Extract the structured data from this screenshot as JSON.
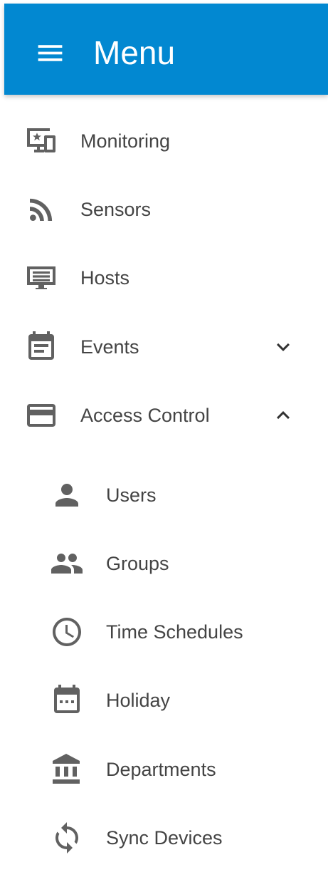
{
  "header": {
    "title": "Menu",
    "menu_icon": "hamburger-menu-icon",
    "background_color": "#0288d1"
  },
  "nav": {
    "items": [
      {
        "label": "Monitoring",
        "icon": "monitoring-devices-icon"
      },
      {
        "label": "Sensors",
        "icon": "rss-feed-icon"
      },
      {
        "label": "Hosts",
        "icon": "host-list-icon"
      },
      {
        "label": "Events",
        "icon": "event-note-icon",
        "expandable": true,
        "expanded": false
      },
      {
        "label": "Access Control",
        "icon": "credit-card-icon",
        "expandable": true,
        "expanded": true,
        "children": [
          {
            "label": "Users",
            "icon": "person-icon"
          },
          {
            "label": "Groups",
            "icon": "people-icon"
          },
          {
            "label": "Time Schedules",
            "icon": "clock-icon"
          },
          {
            "label": "Holiday",
            "icon": "calendar-icon"
          },
          {
            "label": "Departments",
            "icon": "bank-icon"
          },
          {
            "label": "Sync Devices",
            "icon": "sync-icon"
          }
        ]
      }
    ]
  },
  "colors": {
    "icon": "#616161",
    "text": "#444444"
  }
}
